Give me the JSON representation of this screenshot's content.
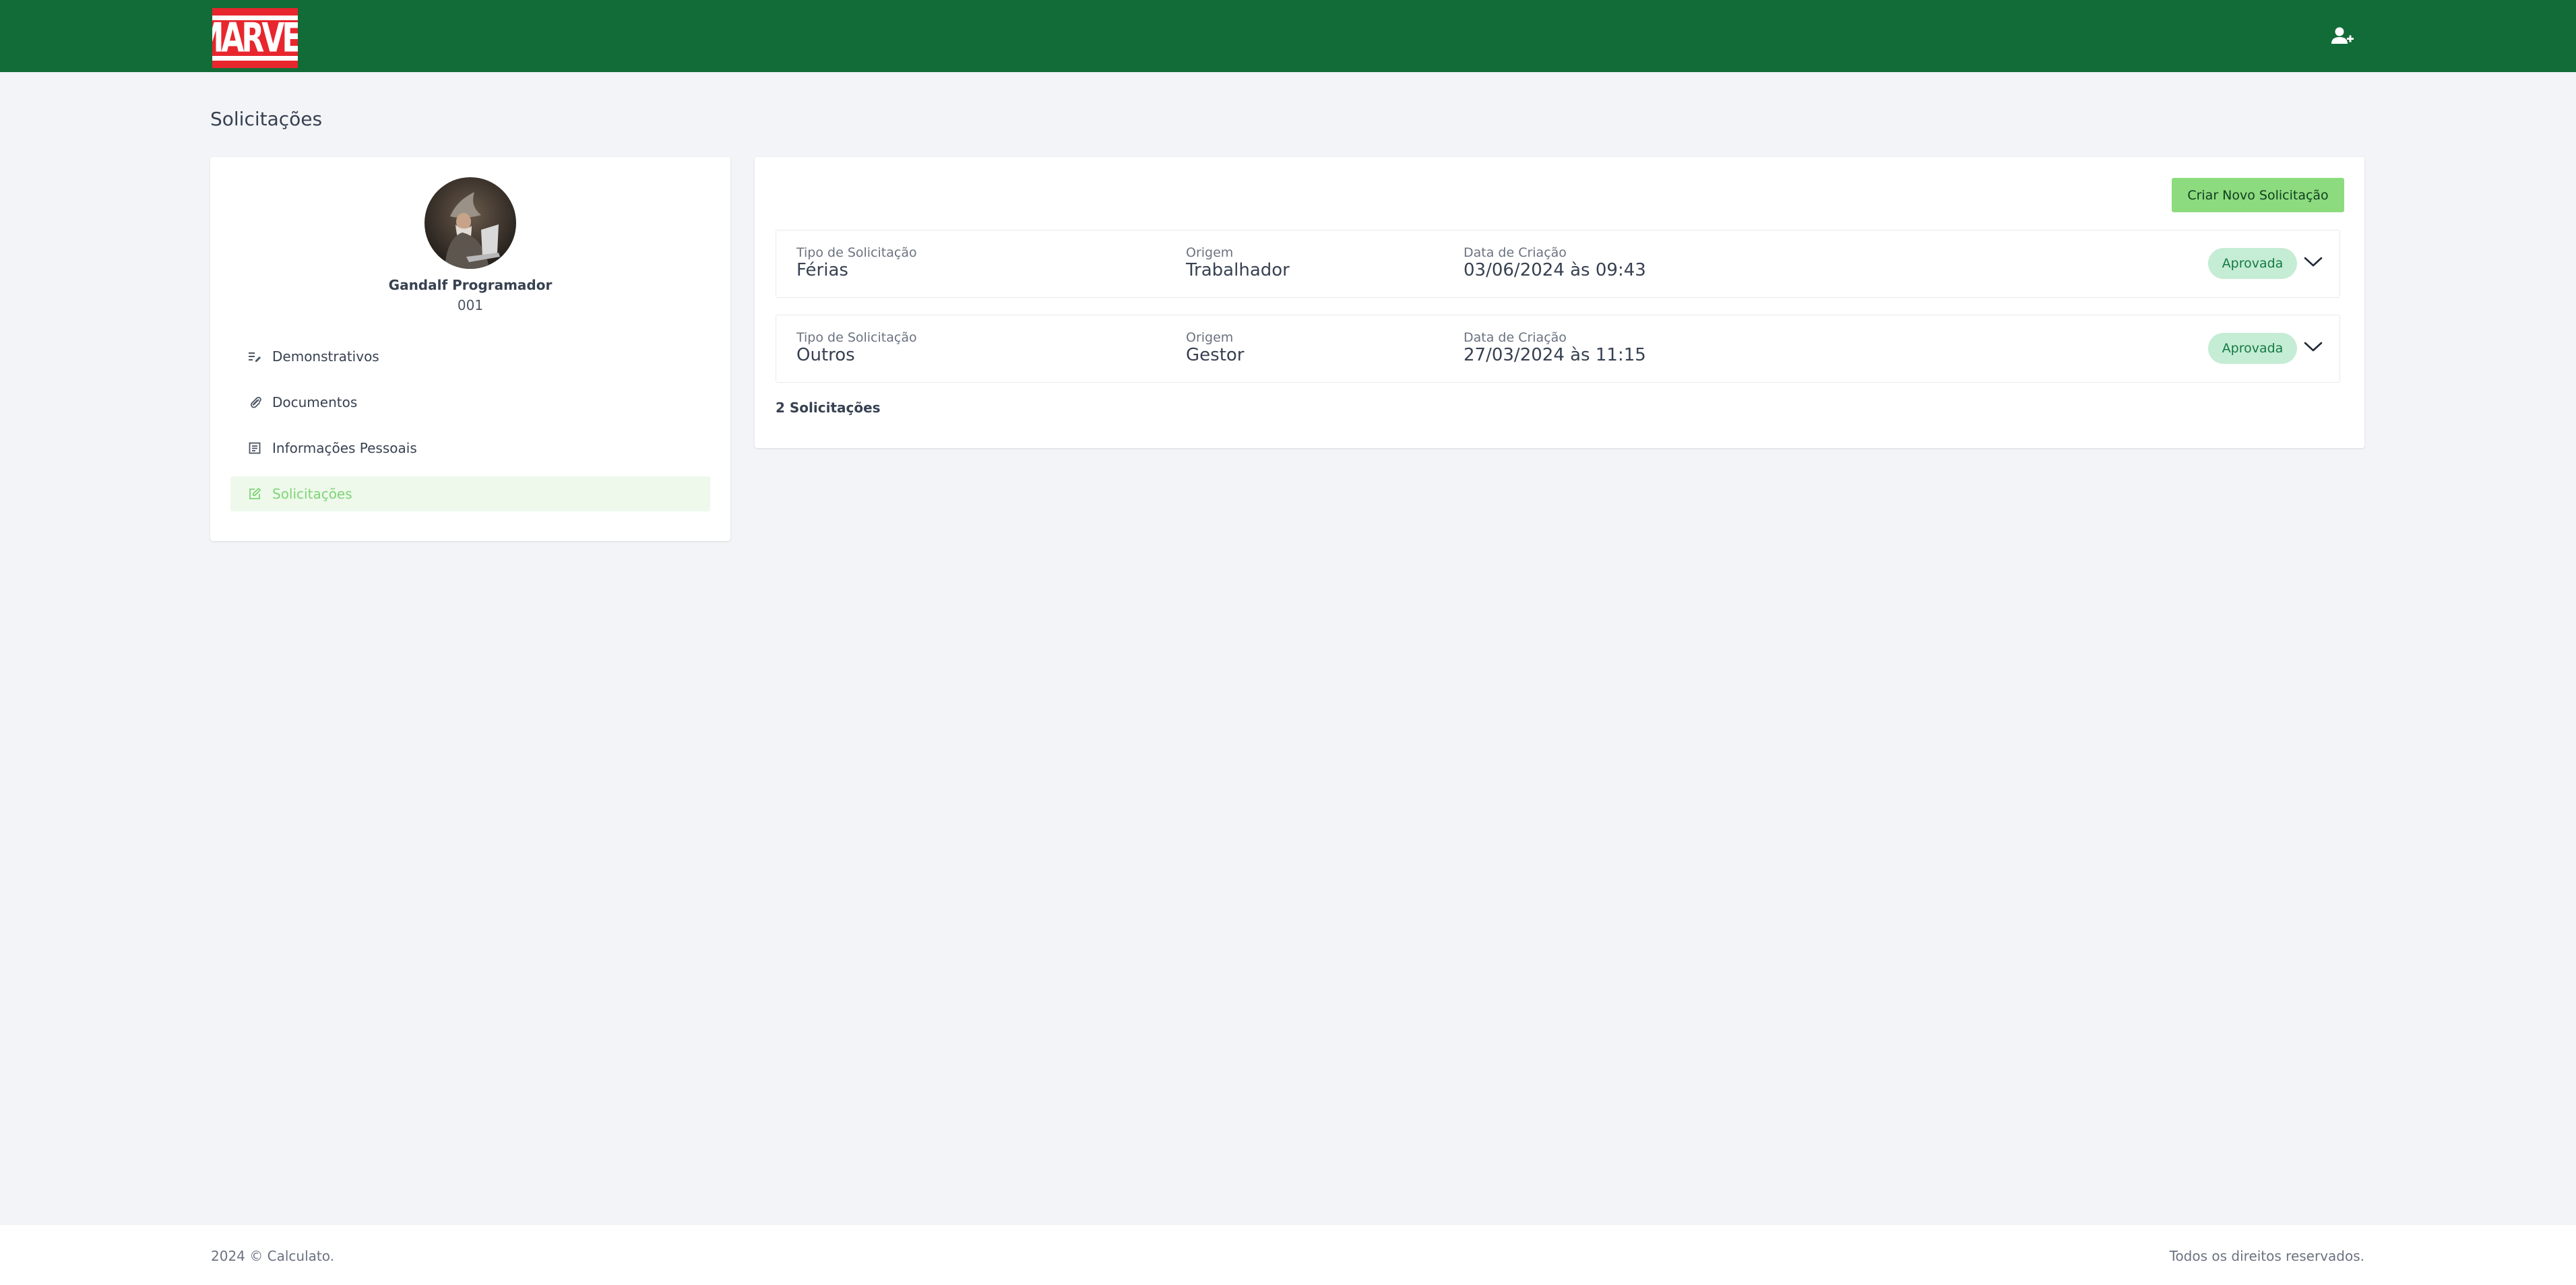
{
  "header": {
    "logo_text": "MARVEL",
    "user_menu_icon": "person-add-icon",
    "brand_color": "#126c37"
  },
  "page": {
    "title": "Solicitações"
  },
  "profile": {
    "name": "Gandalf Programador",
    "id": "001",
    "avatar": "avatar-photo"
  },
  "nav": {
    "items": [
      {
        "label": "Demonstrativos",
        "icon": "edit-list-icon",
        "active": false
      },
      {
        "label": "Documentos",
        "icon": "paperclip-icon",
        "active": false
      },
      {
        "label": "Informações Pessoais",
        "icon": "document-list-icon",
        "active": false
      },
      {
        "label": "Solicitações",
        "icon": "edit-square-icon",
        "active": true
      }
    ]
  },
  "requests": {
    "create_label": "Criar Novo Solicitação",
    "columns": {
      "type": "Tipo de Solicitação",
      "origin": "Origem",
      "date": "Data de Criação"
    },
    "rows": [
      {
        "type": "Férias",
        "origin": "Trabalhador",
        "date": "03/06/2024 às 09:43",
        "status": "Aprovada"
      },
      {
        "type": "Outros",
        "origin": "Gestor",
        "date": "27/03/2024 às 11:15",
        "status": "Aprovada"
      }
    ],
    "count_label": "2 Solicitações"
  },
  "colors": {
    "accent": "#8cdb7e",
    "active_nav_text": "#7ed474",
    "badge_bg": "#c5ecd4",
    "badge_text": "#137a43"
  },
  "footer": {
    "copyright": "2024 © Calculato.",
    "rights": "Todos os direitos reservados."
  }
}
